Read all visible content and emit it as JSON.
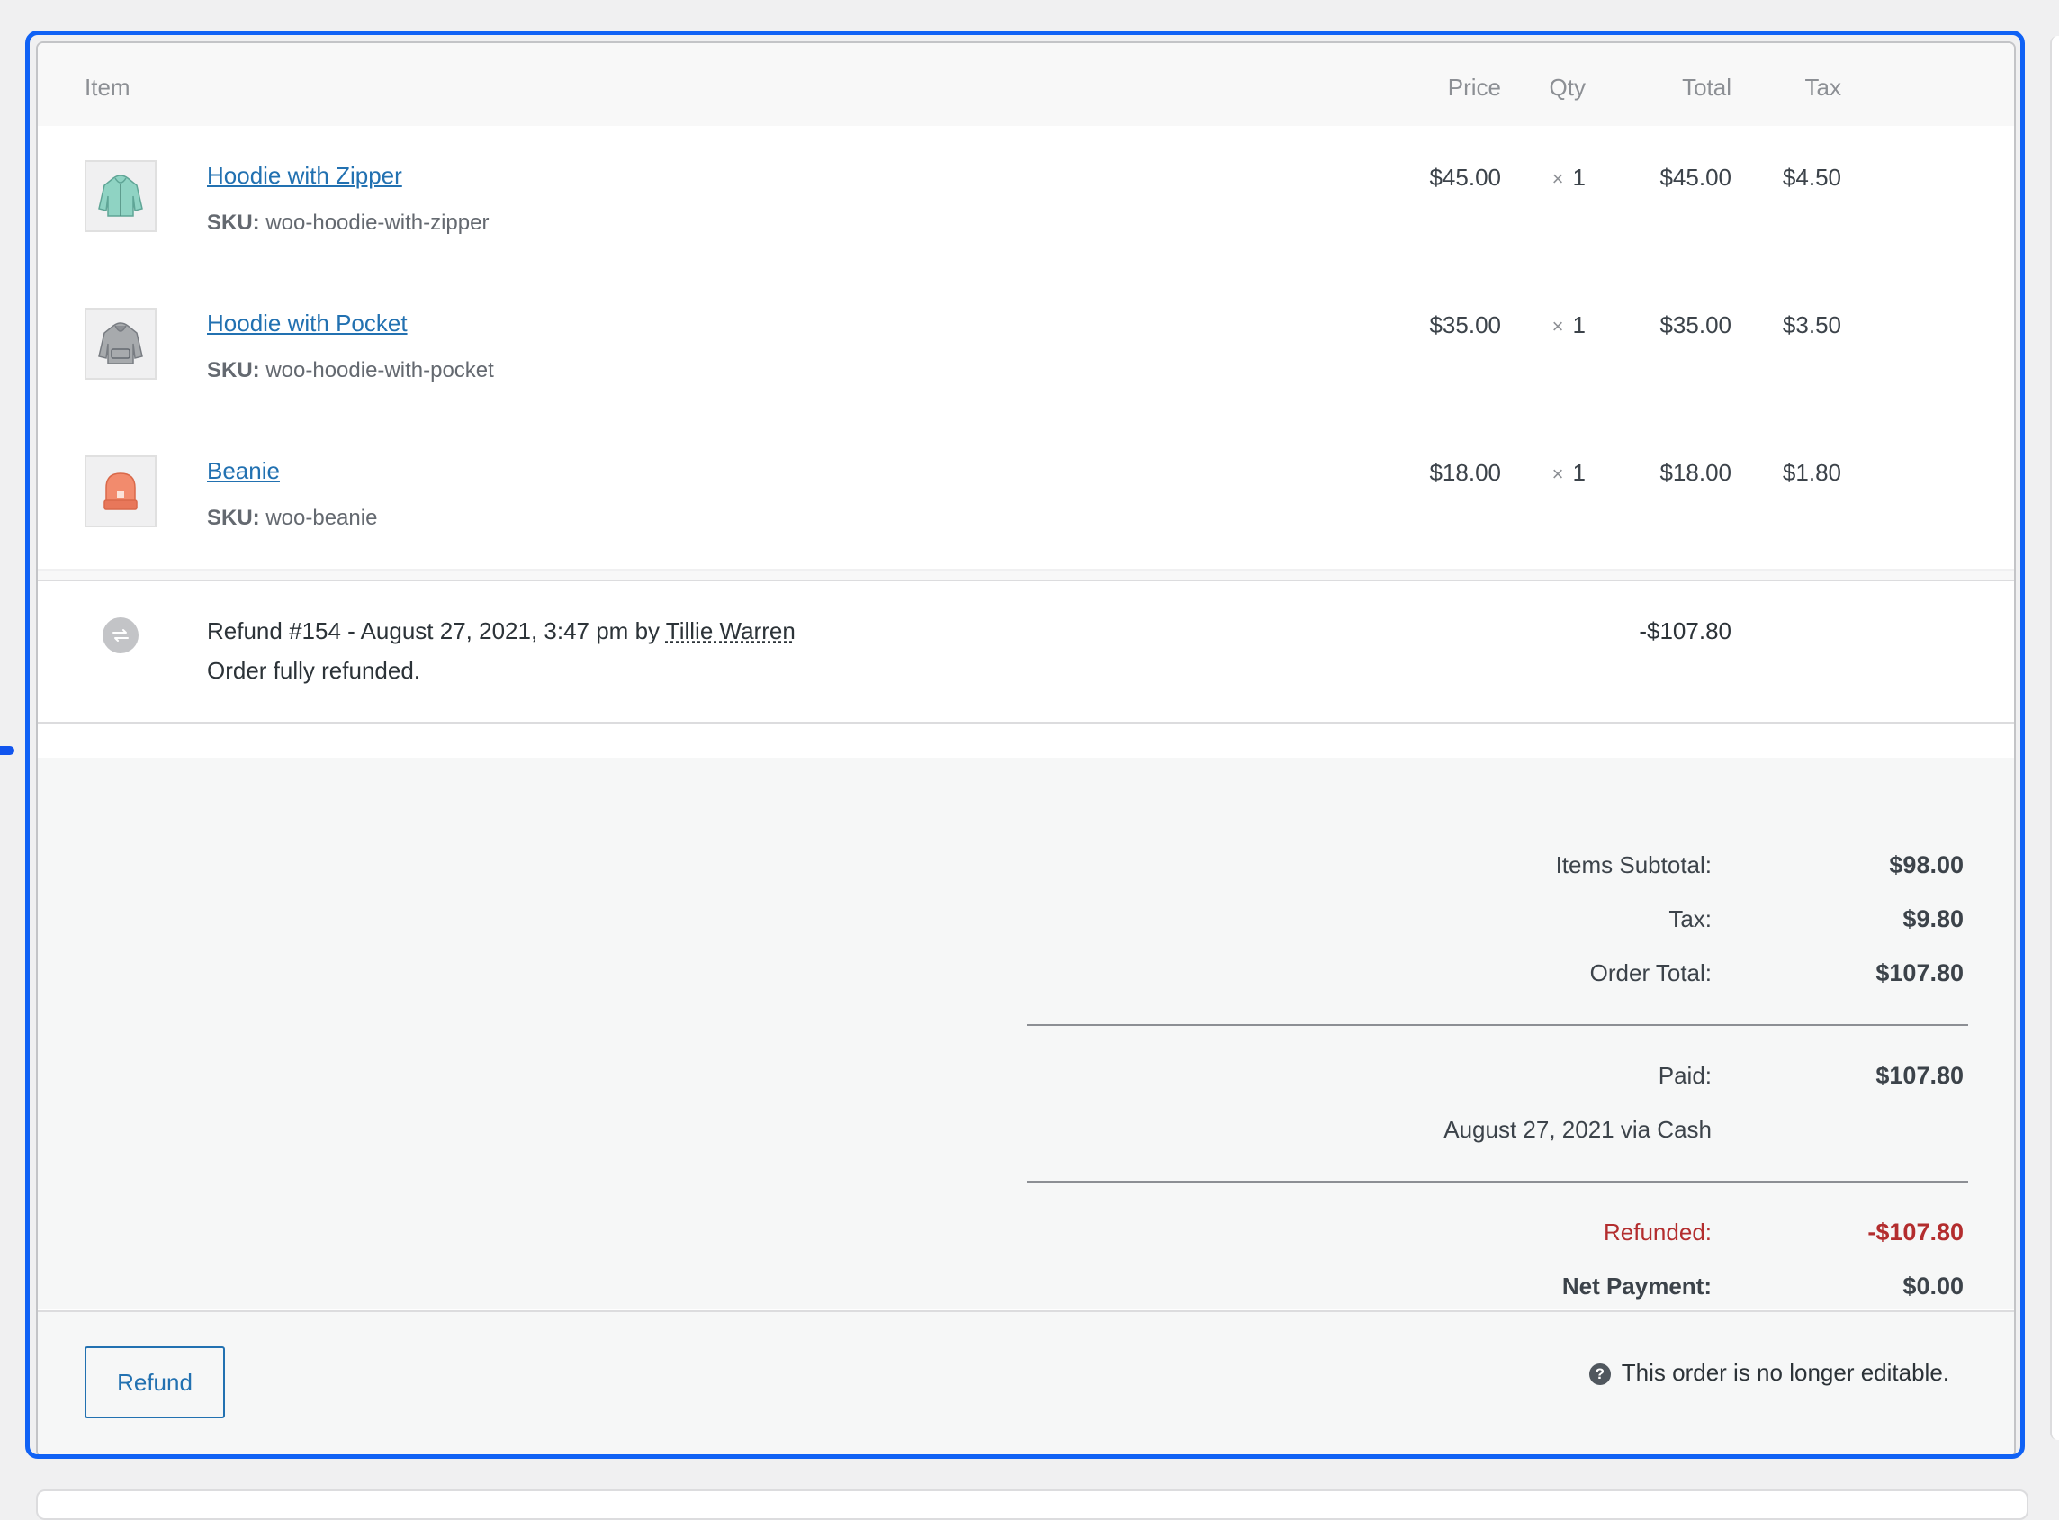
{
  "headers": {
    "item": "Item",
    "price": "Price",
    "qty": "Qty",
    "total": "Total",
    "tax": "Tax"
  },
  "items": [
    {
      "name": "Hoodie with Zipper",
      "sku_label": "SKU:",
      "sku": "woo-hoodie-with-zipper",
      "price": "$45.00",
      "qty_symbol": "×",
      "qty": "1",
      "total": "$45.00",
      "tax": "$4.50",
      "thumb_icon": "hoodie-zipper-icon"
    },
    {
      "name": "Hoodie with Pocket",
      "sku_label": "SKU:",
      "sku": "woo-hoodie-with-pocket",
      "price": "$35.00",
      "qty_symbol": "×",
      "qty": "1",
      "total": "$35.00",
      "tax": "$3.50",
      "thumb_icon": "hoodie-pocket-icon"
    },
    {
      "name": "Beanie",
      "sku_label": "SKU:",
      "sku": "woo-beanie",
      "price": "$18.00",
      "qty_symbol": "×",
      "qty": "1",
      "total": "$18.00",
      "tax": "$1.80",
      "thumb_icon": "beanie-icon"
    }
  ],
  "refund": {
    "text": "Refund #154 - August 27, 2021, 3:47 pm by",
    "author": "Tillie Warren",
    "reason": "Order fully refunded.",
    "amount": "-$107.80"
  },
  "totals": {
    "items_subtotal_label": "Items Subtotal:",
    "items_subtotal": "$98.00",
    "tax_label": "Tax:",
    "tax": "$9.80",
    "order_total_label": "Order Total:",
    "order_total": "$107.80",
    "paid_label": "Paid:",
    "paid": "$107.80",
    "paid_note": "August 27, 2021 via Cash",
    "refunded_label": "Refunded:",
    "refunded": "-$107.80",
    "net_payment_label": "Net Payment:",
    "net_payment": "$0.00"
  },
  "footer": {
    "refund_button": "Refund",
    "help_icon_glyph": "?",
    "note": "This order is no longer editable."
  },
  "colors": {
    "link": "#2271b1",
    "refunded": "#b32d2e",
    "highlight": "#1062f5"
  }
}
